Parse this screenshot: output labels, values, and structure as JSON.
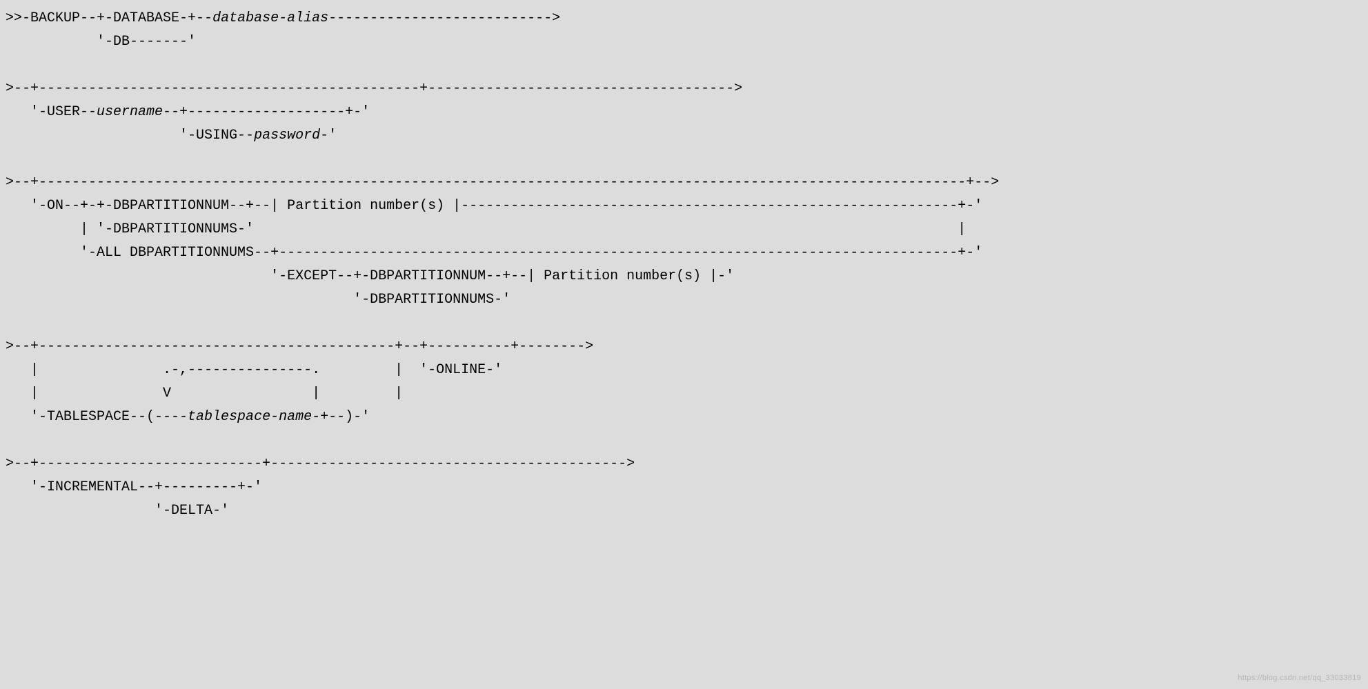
{
  "syntax": {
    "line1_a": ">>-BACKUP--+-DATABASE-+--",
    "line1_it": "database-alias",
    "line1_b": "--------------------------->",
    "line2": "           '-DB-------'",
    "line4": ">--+----------------------------------------------+------------------------------------->",
    "line5_a": "   '-USER--",
    "line5_it": "username",
    "line5_b": "--+-------------------+-'",
    "line6_a": "                     '-USING--",
    "line6_it": "password",
    "line6_b": "-'",
    "line8": ">--+----------------------------------------------------------------------------------------------------------------+-->",
    "line9": "   '-ON--+-+-DBPARTITIONNUM--+--| Partition number(s) |------------------------------------------------------------+-'",
    "line10": "         | '-DBPARTITIONNUMS-'                                                                                     |",
    "line11": "         '-ALL DBPARTITIONNUMS--+----------------------------------------------------------------------------------+-'",
    "line12": "                                '-EXCEPT--+-DBPARTITIONNUM--+--| Partition number(s) |-'",
    "line13": "                                          '-DBPARTITIONNUMS-'",
    "line15": ">--+-------------------------------------------+--+----------+-------->",
    "line16": "   |               .-,---------------.         |  '-ONLINE-'",
    "line17": "   |               V                 |         |",
    "line18_a": "   '-TABLESPACE--(----",
    "line18_it": "tablespace-name",
    "line18_b": "-+--)-'",
    "line20": ">--+---------------------------+------------------------------------------->",
    "line21": "   '-INCREMENTAL--+---------+-'",
    "line22": "                  '-DELTA-'"
  },
  "watermark": "https://blog.csdn.net/qq_33033819"
}
